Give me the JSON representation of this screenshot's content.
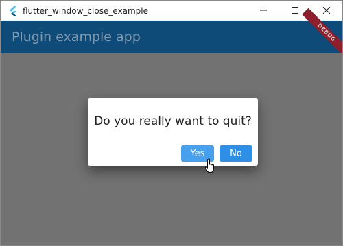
{
  "window": {
    "title": "flutter_window_close_example",
    "controls": [
      "minimize",
      "maximize",
      "close"
    ]
  },
  "appbar": {
    "title": "Plugin example app",
    "debug_banner": "DEBUG"
  },
  "dialog": {
    "message": "Do you really want to quit?",
    "yes_label": "Yes",
    "no_label": "No"
  },
  "colors": {
    "appbar": "#0f4b78",
    "button": "#2f8fe6",
    "debug_banner": "#8c1f2b",
    "scrim": "#727272"
  },
  "icons": {
    "app": "flutter-logo-icon",
    "minimize": "minimize-icon",
    "maximize": "maximize-icon",
    "close": "close-icon",
    "cursor": "hand-pointer-icon"
  }
}
